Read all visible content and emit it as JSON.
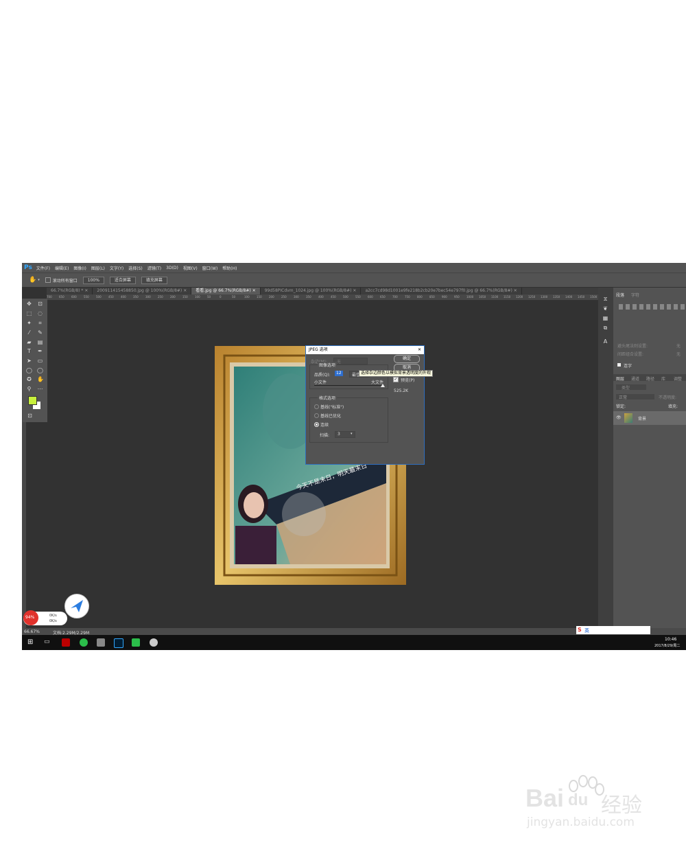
{
  "menubar": {
    "logo": "Ps",
    "items": [
      "文件(F)",
      "编辑(E)",
      "图像(I)",
      "图层(L)",
      "文字(Y)",
      "选择(S)",
      "滤镜(T)",
      "3D(D)",
      "视图(V)",
      "窗口(W)",
      "帮助(H)"
    ]
  },
  "options": {
    "scroll_all": "滚动所有窗口",
    "zoom_100": "100%",
    "fit_screen": "适合屏幕",
    "fill_screen": "填充屏幕"
  },
  "tabs": [
    {
      "label": "66.7%(RGB/8) *",
      "active": false
    },
    {
      "label": "200911415458850.jpg @ 100%(RGB/8#)",
      "active": false
    },
    {
      "label": "看看.jpg @ 66.7%(RGB/8#)",
      "active": true
    },
    {
      "label": "99d58PICdvm_1024.jpg @ 100%(RGB/8#)",
      "active": false
    },
    {
      "label": "a2cc7cd98d1001e9fe218b2cb20e7bec54e797f0.jpg @ 66.7%(RGB/8#)",
      "active": false
    }
  ],
  "ruler_ticks": [
    "700",
    "650",
    "600",
    "550",
    "500",
    "450",
    "400",
    "350",
    "300",
    "250",
    "200",
    "150",
    "100",
    "50",
    "0",
    "50",
    "100",
    "150",
    "200",
    "250",
    "300",
    "350",
    "400",
    "450",
    "500",
    "550",
    "600",
    "650",
    "700",
    "750",
    "800",
    "850",
    "900",
    "950",
    "1000",
    "1050",
    "1100",
    "1150",
    "1200",
    "1250",
    "1300",
    "1350",
    "1400",
    "1450",
    "1500",
    "155"
  ],
  "canvas": {
    "text": "今天不是末日，明天最末日"
  },
  "dialog": {
    "title": "JPEG 选项",
    "close": "✕",
    "matte_label": "杂边(M):",
    "matte_value": "无",
    "ok": "确定",
    "cancel": "取消",
    "image_options": "图像选项",
    "quality_label": "品质(Q):",
    "quality_value": "12",
    "quality_select": "最佳",
    "small_file": "小文件",
    "large_file": "大文件",
    "preview_label": "预览(P)",
    "file_size": "525.2K",
    "format_options": "格式选项",
    "baseline_standard": "基线(\"标准\")",
    "baseline_optimized": "基线已优化",
    "progressive": "连续",
    "scans_label": "扫描:",
    "scans_value": "3",
    "quality_fraction": 1.0
  },
  "tooltip": "选择杂边颜色以模拟背景透明度的外观",
  "right_panel": {
    "tab_paragraph": "段落",
    "tab_char": "字符",
    "hyphenate": "连字",
    "layers_tabs": [
      "图层",
      "通道",
      "路径",
      "库",
      "调整"
    ],
    "kind": "类型",
    "blend": "正常",
    "opacity": "不透明度:",
    "lock": "锁定:",
    "fill": "填充:",
    "layer_name": "背景",
    "opt1": "避头尾法则设置:",
    "opt2": "间距组合设置:",
    "none": "无"
  },
  "status": {
    "zoom": "66.67%",
    "doc": "文档:2.29M/2.29M",
    "gauge": "94%",
    "up": "0K/s",
    "down": "0K/s"
  },
  "taskbar": {
    "time": "10:46",
    "date": "2017/8/29/周二",
    "ime": "英"
  },
  "watermark": {
    "brand": "Bai",
    "brand2": "du",
    "cn": "经验",
    "url": "jingyan.baidu.com"
  },
  "colors": {
    "ps_bg": "#323232",
    "ps_panel": "#535353",
    "fg_swatch": "#c8f03c",
    "accent": "#31a8ff"
  }
}
